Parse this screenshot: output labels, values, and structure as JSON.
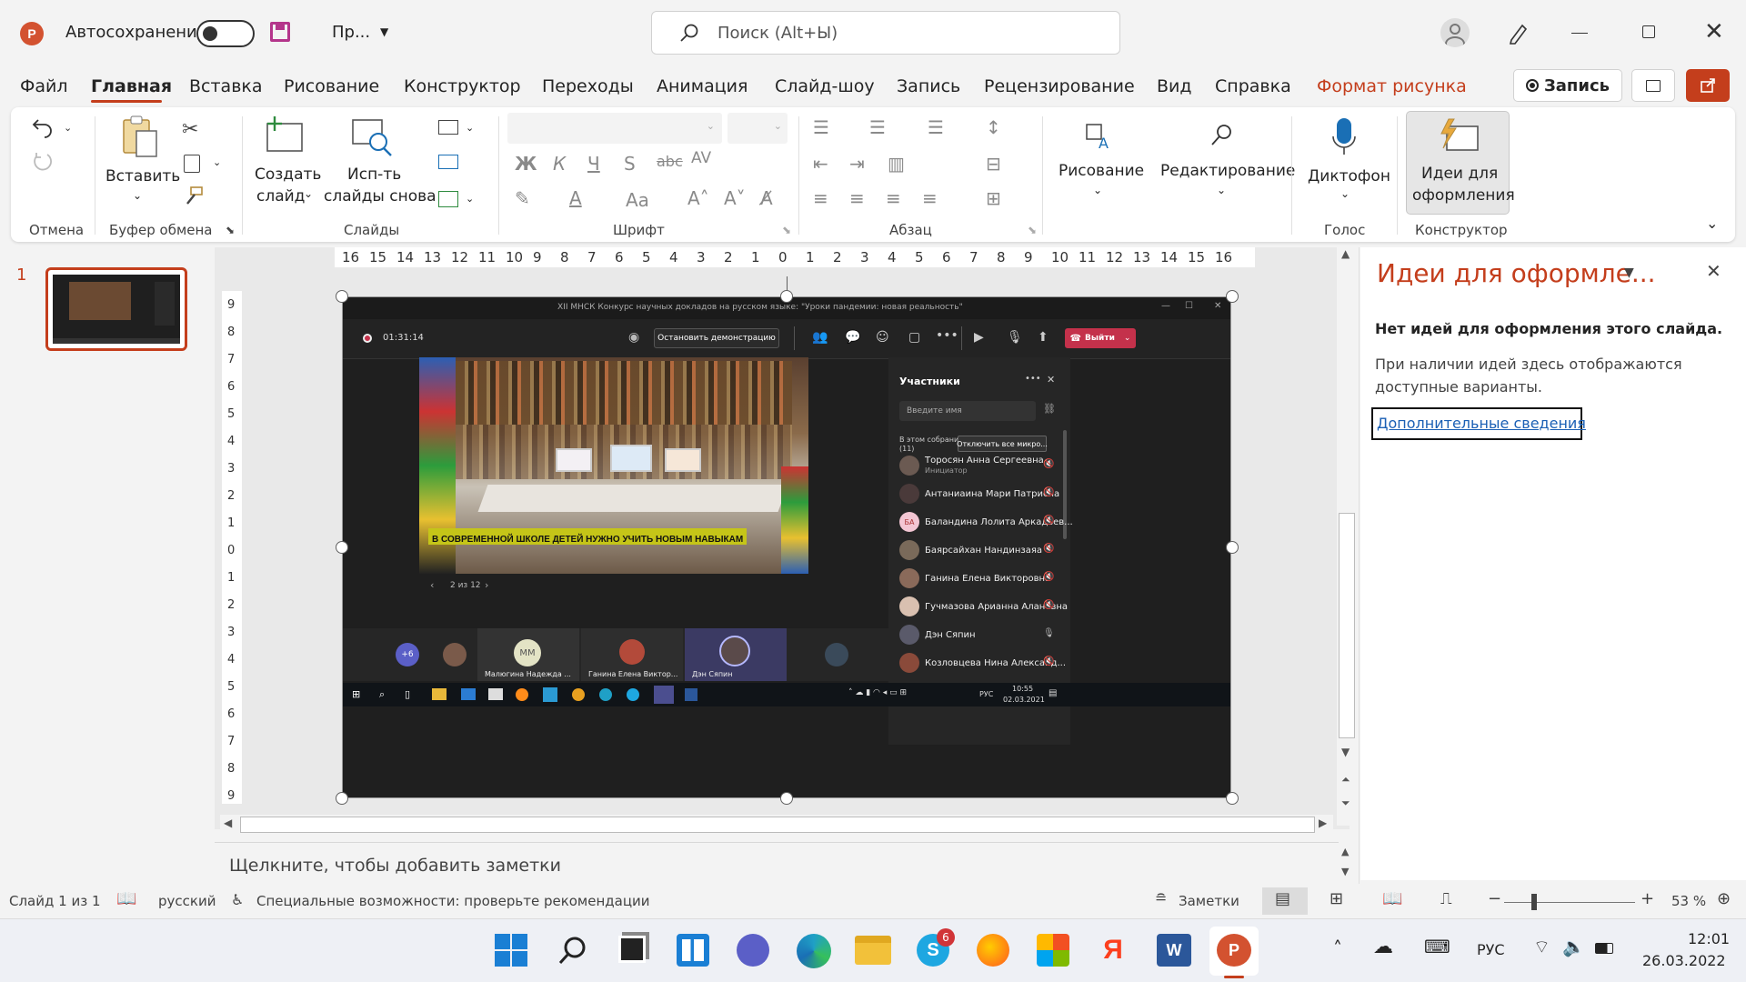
{
  "titlebar": {
    "autosave_label": "Автосохранение",
    "doc_name": "Пр...",
    "search_placeholder": "Поиск (Alt+Ы)"
  },
  "menu": {
    "items": [
      "Файл",
      "Главная",
      "Вставка",
      "Рисование",
      "Конструктор",
      "Переходы",
      "Анимация",
      "Слайд-шоу",
      "Запись",
      "Рецензирование",
      "Вид",
      "Справка",
      "Формат рисунка"
    ],
    "record_button": "Запись"
  },
  "ribbon": {
    "groups": {
      "undo": "Отмена",
      "clipboard": "Буфер обмена",
      "slides": "Слайды",
      "font": "Шрифт",
      "paragraph": "Абзац",
      "voice": "Голос",
      "designer": "Конструктор"
    },
    "paste": "Вставить",
    "new_slide_1": "Создать",
    "new_slide_2": "слайд",
    "reuse_1": "Исп-ть",
    "reuse_2": "слайды снова",
    "drawing": "Рисование",
    "editing": "Редактирование",
    "dictate": "Диктофон",
    "ideas_1": "Идеи для",
    "ideas_2": "оформления"
  },
  "ruler": {
    "h_ticks": [
      "16",
      "15",
      "14",
      "13",
      "12",
      "11",
      "10",
      "9",
      "8",
      "7",
      "6",
      "5",
      "4",
      "3",
      "2",
      "1",
      "0",
      "1",
      "2",
      "3",
      "4",
      "5",
      "6",
      "7",
      "8",
      "9",
      "10",
      "11",
      "12",
      "13",
      "14",
      "15",
      "16"
    ],
    "v_ticks": [
      "9",
      "8",
      "7",
      "6",
      "5",
      "4",
      "3",
      "2",
      "1",
      "0",
      "1",
      "2",
      "3",
      "4",
      "5",
      "6",
      "7",
      "8",
      "9"
    ]
  },
  "thumb": {
    "number": "1"
  },
  "slide": {
    "window_title": "XII МНСК Конкурс научных докладов на русском языке: \"Уроки пандемии: новая реальность\"",
    "timer": "01:31:14",
    "stop_demo": "Остановить демонстрацию",
    "leave": "Выйти",
    "caption": "В СОВРЕМЕННОЙ ШКОЛЕ ДЕТЕЙ НУЖНО УЧИТЬ НОВЫМ НАВЫКАМ",
    "pager": "2 из 12",
    "participants_title": "Участники",
    "name_placeholder": "Введите имя",
    "in_meeting": "В этом собрании",
    "in_meeting_count": "(11)",
    "mute_all": "Отключить все микро...",
    "participants": [
      {
        "name": "Торосян Анна Сергеевна",
        "role": "Инициатор"
      },
      {
        "name": "Антаниаина Мари Патрисиа",
        "role": ""
      },
      {
        "name": "Баландина Лолита Аркадьев...",
        "role": "",
        "initials": "БА"
      },
      {
        "name": "Баярсайхан Нандинзаяа",
        "role": ""
      },
      {
        "name": "Ганина Елена Викторовна",
        "role": ""
      },
      {
        "name": "Гучмазова Арианна Алановна",
        "role": ""
      },
      {
        "name": "Дэн Сяпин",
        "role": ""
      },
      {
        "name": "Козловцева Нина Александ...",
        "role": ""
      }
    ],
    "video_tiles": [
      {
        "label": "+6"
      },
      {
        "label": "Малюгина Надежда ...",
        "initials": "ММ"
      },
      {
        "label": "Ганина Елена Виктор..."
      },
      {
        "label": "Дэн Сяпин"
      }
    ],
    "inner_time": "10:55",
    "inner_date": "02.03.2021",
    "inner_lang": "РУС"
  },
  "notes": {
    "placeholder": "Щелкните, чтобы добавить заметки"
  },
  "designer_pane": {
    "title": "Идеи для оформле...",
    "heading": "Нет идей для оформления этого слайда.",
    "body": "При наличии идей здесь отображаются доступные варианты.",
    "link": "Дополнительные сведения"
  },
  "status": {
    "slide": "Слайд 1 из 1",
    "language": "русский",
    "accessibility": "Специальные возможности: проверьте рекомендации",
    "notes": "Заметки",
    "zoom": "53 %"
  },
  "taskbar": {
    "lang": "РУС",
    "time": "12:01",
    "date": "26.03.2022",
    "skype_badge": "6"
  },
  "colors": {
    "accent_red": "#c43e1c",
    "powerpoint": "#d35230",
    "teams_leave": "#c4314b"
  }
}
